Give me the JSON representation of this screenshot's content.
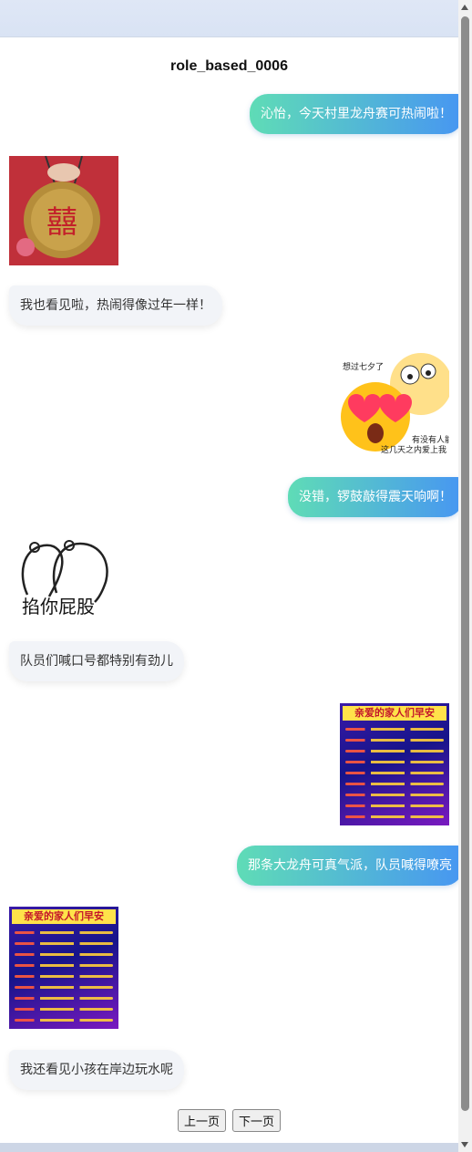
{
  "page": {
    "title": "role_based_0006"
  },
  "messages": [
    {
      "side": "right",
      "type": "text",
      "text": "沁怡，今天村里龙舟赛可热闹啦！"
    },
    {
      "side": "left",
      "type": "image",
      "icon": "gong-sticker-icon"
    },
    {
      "side": "left",
      "type": "text",
      "text": "我也看见啦，热闹得像过年一样！"
    },
    {
      "side": "right",
      "type": "image",
      "icon": "heart-eyes-emoji-sticker",
      "text_top": "想过七夕了",
      "text_bottom_1": "有没有人能在",
      "text_bottom_2": "这几天之内爱上我"
    },
    {
      "side": "right",
      "type": "text",
      "text": "没错，锣鼓敲得震天响啊！"
    },
    {
      "side": "left",
      "type": "image",
      "icon": "bear-sketch-sticker",
      "caption": "掐你屁股"
    },
    {
      "side": "left",
      "type": "text",
      "text": "队员们喊口号都特别有劲儿"
    },
    {
      "side": "right",
      "type": "image",
      "icon": "greeting-card-sticker",
      "card_title": "亲爱的家人们早安"
    },
    {
      "side": "right",
      "type": "text",
      "text": "那条大龙舟可真气派，队员喊得嘹亮"
    },
    {
      "side": "left",
      "type": "image",
      "icon": "greeting-card-sticker",
      "card_title": "亲爱的家人们早安"
    },
    {
      "side": "left",
      "type": "text",
      "text": "我还看见小孩在岸边玩水呢"
    }
  ],
  "pager": {
    "prev_label": "上一页",
    "next_label": "下一页"
  },
  "colors": {
    "bubble_right_start": "#5fdcb6",
    "bubble_right_end": "#4796f2",
    "bubble_left": "#f2f4f8"
  }
}
